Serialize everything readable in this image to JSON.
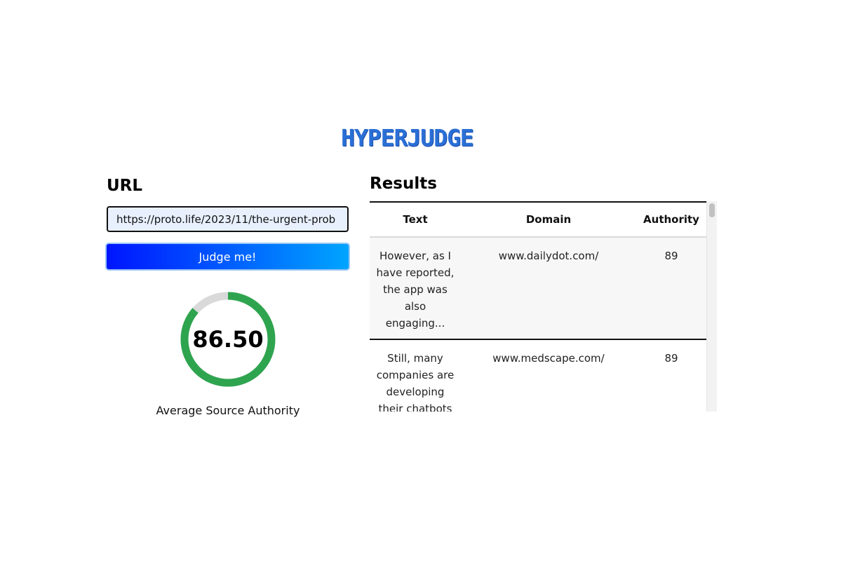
{
  "brand": {
    "logo_text": "HYPERJUDGE"
  },
  "url_section": {
    "heading": "URL",
    "input_value": "https://proto.life/2023/11/the-urgent-prob",
    "button_label": "Judge me!"
  },
  "score": {
    "value": "86.50",
    "fraction": 0.865,
    "caption": "Average Source Authority",
    "color": "#2fa44f",
    "track_color": "#d9d9d9"
  },
  "results": {
    "heading": "Results",
    "columns": [
      "Text",
      "Domain",
      "Authority"
    ],
    "rows": [
      {
        "text": "However, as I have reported, the app was also engaging...",
        "domain": "www.dailydot.com/",
        "authority": "89"
      },
      {
        "text": "Still, many companies are developing their chatbots",
        "domain": "www.medscape.com/",
        "authority": "89"
      }
    ]
  }
}
